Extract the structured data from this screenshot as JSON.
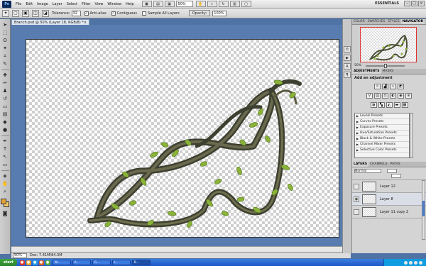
{
  "menu": {
    "logo": "Ps",
    "items": [
      "File",
      "Edit",
      "Image",
      "Layer",
      "Select",
      "Filter",
      "View",
      "Window",
      "Help"
    ],
    "zoom": "50%",
    "workspace": "ESSENTIALS"
  },
  "options": {
    "tolerance_label": "Tolerance:",
    "tolerance_value": "32",
    "antialias_label": "Anti-alias",
    "contiguous_label": "Contiguous",
    "sample_label": "Sample All Layers",
    "opacity_label": "Opacity:",
    "opacity_value": "100%"
  },
  "document": {
    "tab_title": "Branch.psd @ 50% (Layer 18, RGB/8) *",
    "close": "×"
  },
  "status": {
    "zoom": "50%",
    "doc_info": "Doc: 7.41M/84.3M"
  },
  "panels": {
    "nav_tabs": [
      "COLOR",
      "SWATCHES",
      "STYLES",
      "NAVIGATOR"
    ],
    "nav_zoom": "50%",
    "adj_tabs": [
      "ADJUSTMENTS",
      "MASKS"
    ],
    "adj_title": "Add an adjustment",
    "presets": [
      "Levels Presets",
      "Curves Presets",
      "Exposure Presets",
      "Hue/Saturation Presets",
      "Black & White Presets",
      "Channel Mixer Presets",
      "Selective Color Presets"
    ],
    "layer_tabs": [
      "LAYERS",
      "CHANNELS",
      "PATHS"
    ],
    "layer_mode": "Normal",
    "layers": [
      "Layer 12",
      "Layer 8",
      "Layer 11 copy 2"
    ]
  },
  "taskbar": {
    "start": "start",
    "tasks": [
      "W...",
      "A...",
      "G...",
      "I...",
      "B..."
    ]
  },
  "colors": {
    "foreground": "#e6a33a",
    "background": "#f6cf6a",
    "workspace": "#587cb0"
  }
}
